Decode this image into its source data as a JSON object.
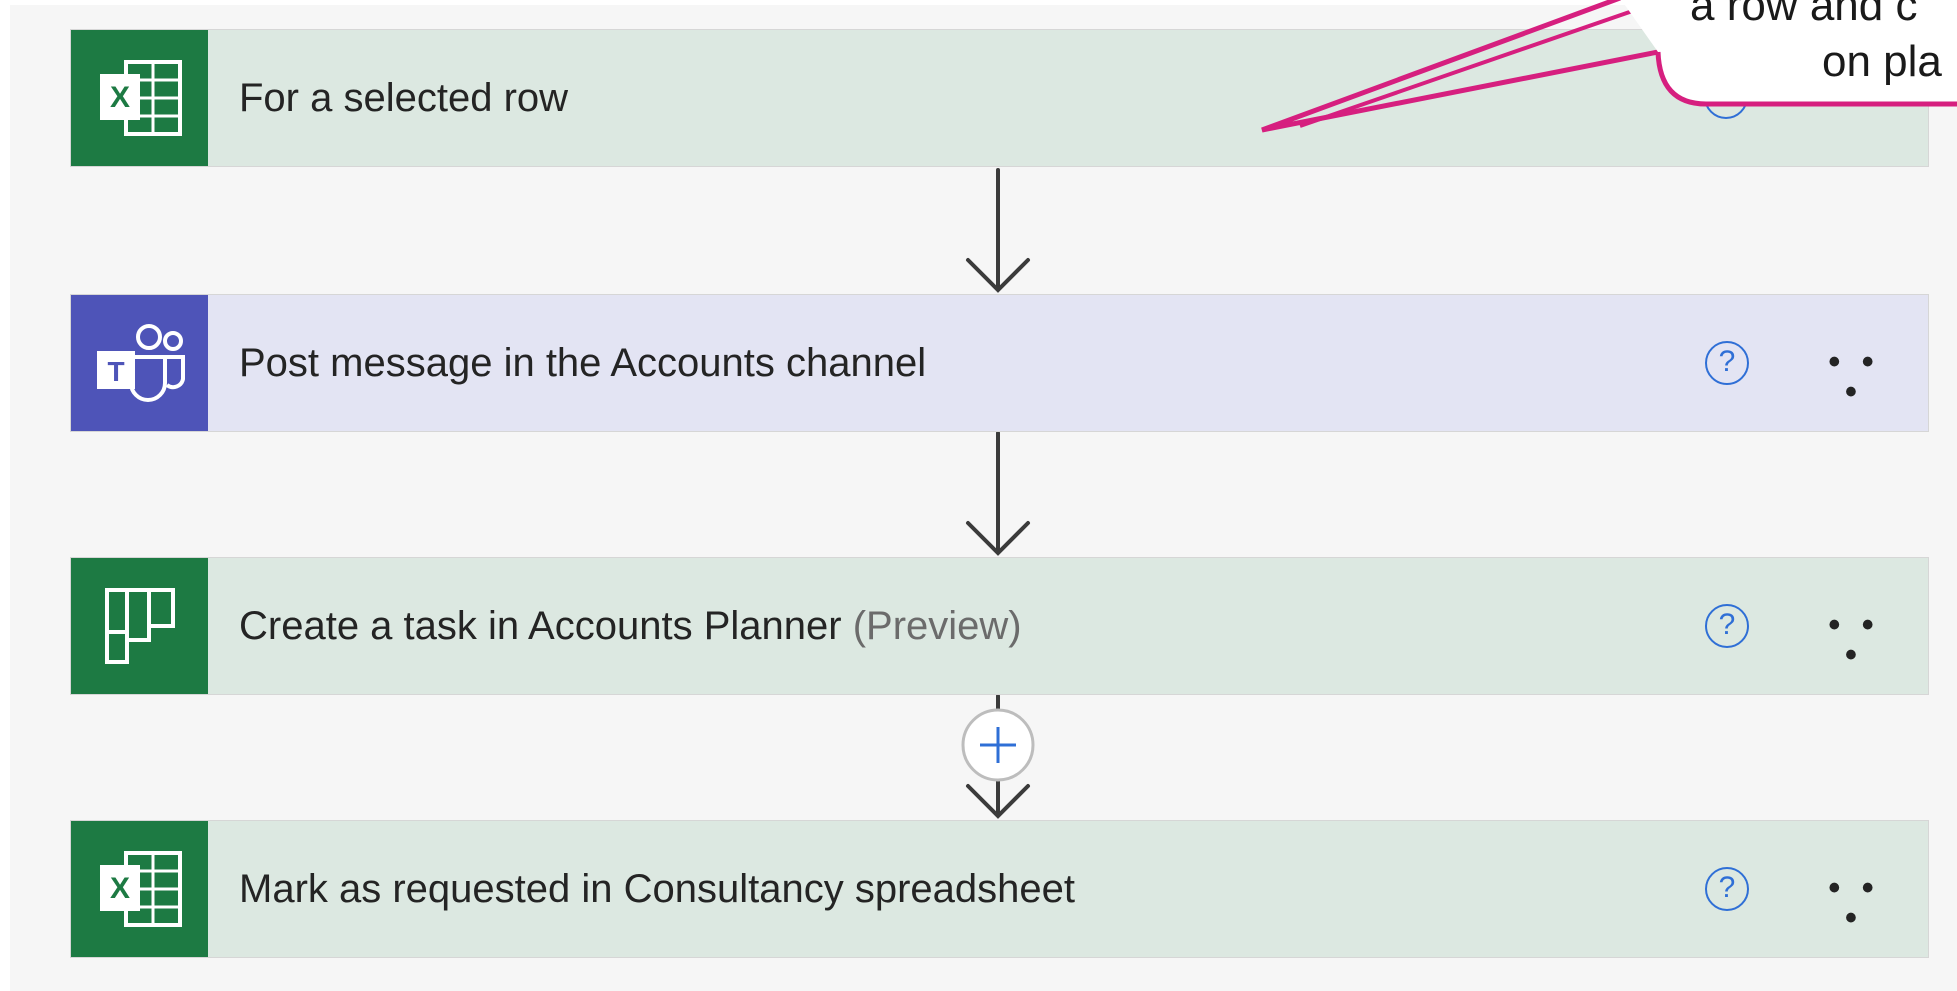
{
  "steps": [
    {
      "kind": "excel",
      "icon": "excel-icon",
      "title": "For a selected row",
      "suffix": ""
    },
    {
      "kind": "teams",
      "icon": "teams-icon",
      "title": "Post message in the Accounts channel",
      "suffix": ""
    },
    {
      "kind": "planner",
      "icon": "planner-icon",
      "title": "Create a task in Accounts Planner",
      "suffix": "(Preview)"
    },
    {
      "kind": "excel",
      "icon": "excel-icon",
      "title": "Mark as requested in Consultancy spreadsheet",
      "suffix": ""
    }
  ],
  "step_actions": {
    "help_glyph": "?",
    "more_glyph": "• • •"
  },
  "connector": {
    "add_icon": "plus-icon"
  },
  "callout": {
    "line1": "a row and c",
    "line2": "on pla",
    "border_color": "#d61f7f"
  },
  "colors": {
    "excel_tile": "#1d7a43",
    "teams_tile": "#4e54b8",
    "excel_card": "#dce8e1",
    "teams_card": "#e3e4f3",
    "help_blue": "#2f6fd6"
  }
}
